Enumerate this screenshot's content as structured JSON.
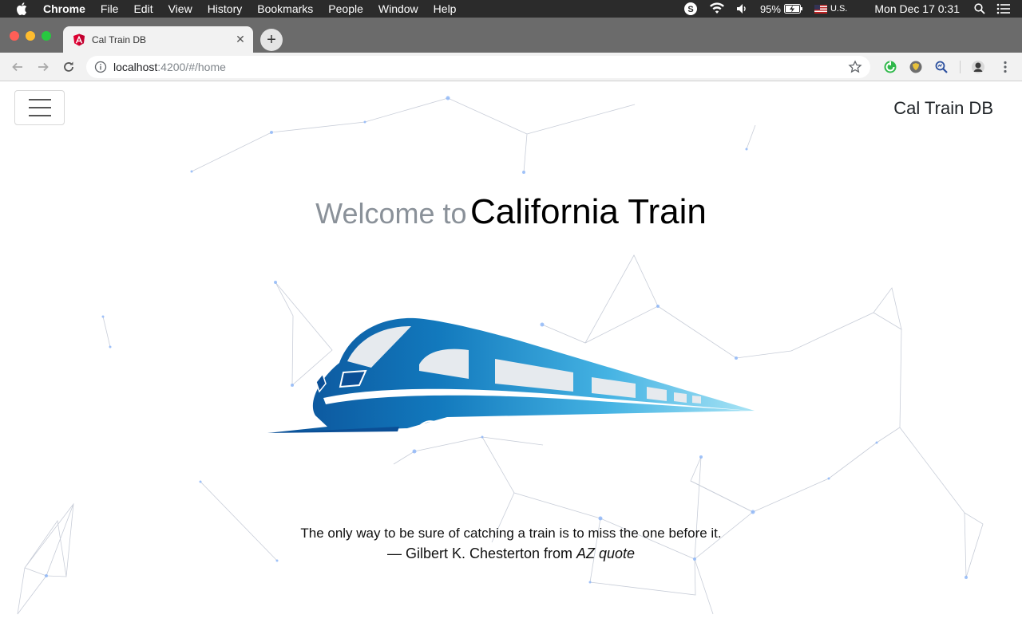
{
  "menubar": {
    "app_name": "Chrome",
    "items": [
      "File",
      "Edit",
      "View",
      "History",
      "Bookmarks",
      "People",
      "Window",
      "Help"
    ],
    "battery": "95%",
    "input_source": "U.S.",
    "datetime": "Mon Dec 17  0:31"
  },
  "browser": {
    "tab_title": "Cal Train DB",
    "url_host": "localhost",
    "url_path": ":4200/#/home"
  },
  "page": {
    "brand": "Cal Train DB",
    "welcome_prefix": "Welcome to",
    "welcome_title": "California Train",
    "quote": "The only way to be sure of catching a train is to miss the one before it.",
    "attribution": "— Gilbert K. Chesterton from ",
    "attribution_source": "AZ quote"
  },
  "colors": {
    "train_dark": "#0b4f96",
    "train_light": "#7fd3ee",
    "network_line": "#9aa4b8",
    "network_node": "#8ab4f8"
  }
}
